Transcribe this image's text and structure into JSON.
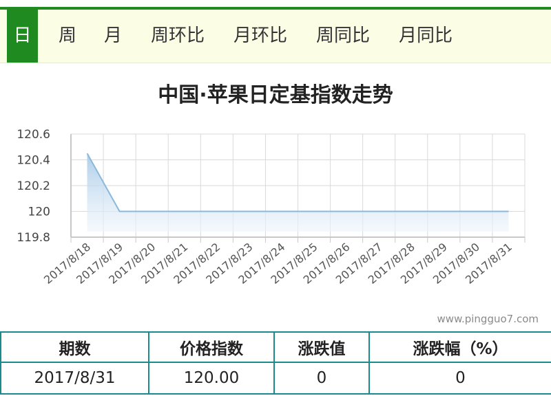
{
  "tabs": [
    {
      "label": "日",
      "active": true
    },
    {
      "label": "周",
      "active": false
    },
    {
      "label": "月",
      "active": false
    },
    {
      "label": "周环比",
      "active": false
    },
    {
      "label": "月环比",
      "active": false
    },
    {
      "label": "周同比",
      "active": false
    },
    {
      "label": "月同比",
      "active": false
    }
  ],
  "watermark": "www.pingguo7.com",
  "chart_data": {
    "type": "area",
    "title": "中国·苹果日定基指数走势",
    "x": [
      "2017/8/18",
      "2017/8/19",
      "2017/8/20",
      "2017/8/21",
      "2017/8/22",
      "2017/8/23",
      "2017/8/24",
      "2017/8/25",
      "2017/8/26",
      "2017/8/27",
      "2017/8/28",
      "2017/8/29",
      "2017/8/30",
      "2017/8/31"
    ],
    "series": [
      {
        "values": [
          120.45,
          120,
          120,
          120,
          120,
          120,
          120,
          120,
          120,
          120,
          120,
          120,
          120,
          120
        ]
      }
    ],
    "yticks": [
      "120.6",
      "120.4",
      "120.2",
      "120",
      "119.8"
    ],
    "ylim": [
      119.8,
      120.6
    ],
    "grid": true,
    "colors": {
      "line": "#8ab8dc",
      "fill_top": "#a9cbe8",
      "fill_bottom": "#eef5fb",
      "grid": "#d9d9d9"
    }
  },
  "table": {
    "headers": [
      "期数",
      "价格指数",
      "涨跌值",
      "涨跌幅（%）"
    ],
    "rows": [
      [
        "2017/8/31",
        "120.00",
        "0",
        "0"
      ]
    ]
  }
}
